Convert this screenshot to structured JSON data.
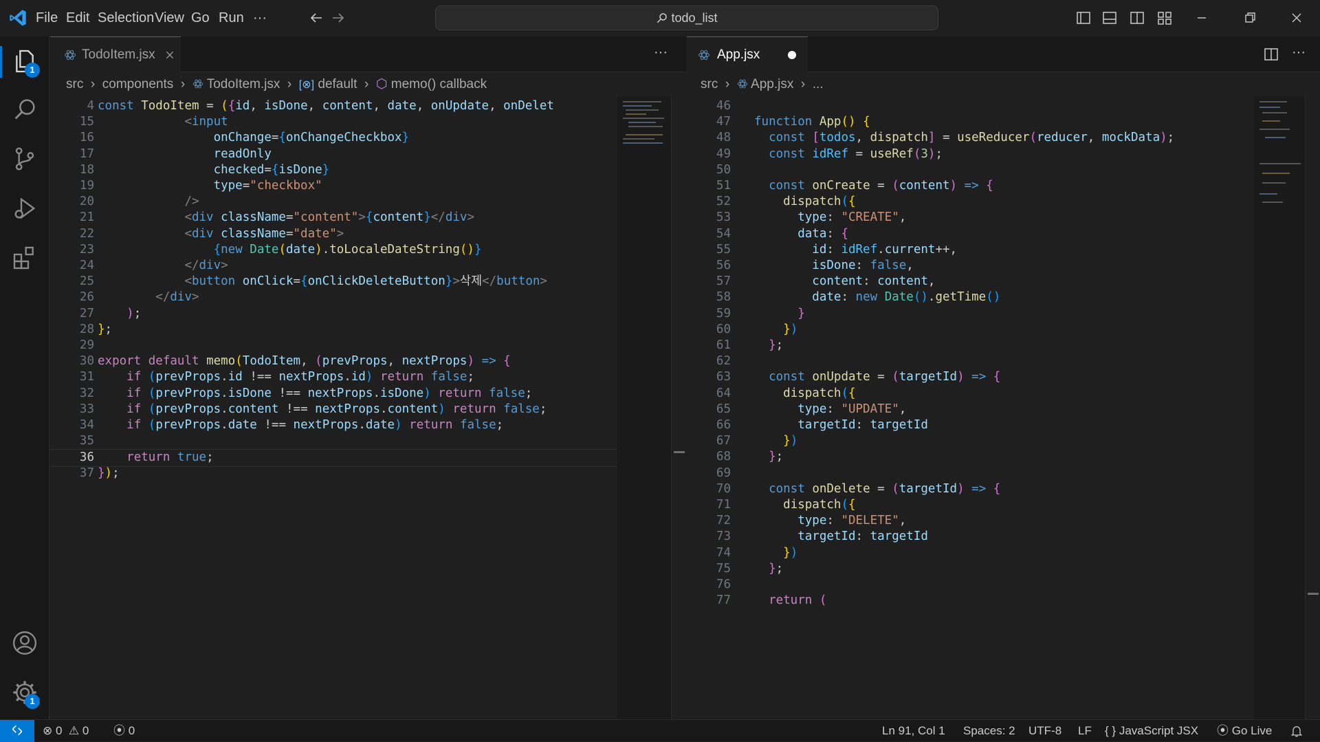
{
  "titlebar": {
    "menu": [
      "File",
      "Edit",
      "Selection",
      "View",
      "Go",
      "Run",
      "···"
    ],
    "search_text": "todo_list"
  },
  "activitybar": {
    "explorer_badge": "1",
    "settings_badge": "1"
  },
  "left_editor": {
    "tab": {
      "label": "TodoItem.jsx"
    },
    "more_label": "···",
    "breadcrumb": [
      "src",
      "components",
      "TodoItem.jsx",
      "default",
      "memo() callback"
    ],
    "lines": [
      {
        "n": "4",
        "html": "<span class=\"kw\">const</span> <span class=\"fn\">TodoItem</span> = <span class=\"br1\">(</span><span class=\"br2\">{</span><span class=\"vr\">id</span>, <span class=\"vr\">isDone</span>, <span class=\"vr\">content</span>, <span class=\"vr\">date</span>, <span class=\"vr\">onUpdate</span>, <span class=\"vr\">onDelet</span>"
      },
      {
        "n": "15",
        "html": "            <span class=\"ang\">&lt;</span><span class=\"tag\">input</span>"
      },
      {
        "n": "16",
        "html": "                <span class=\"vr\">onChange</span>=<span class=\"br3\">{</span><span class=\"vr\">onChangeCheckbox</span><span class=\"br3\">}</span>"
      },
      {
        "n": "17",
        "html": "                <span class=\"vr\">readOnly</span>"
      },
      {
        "n": "18",
        "html": "                <span class=\"vr\">checked</span>=<span class=\"br3\">{</span><span class=\"vr\">isDone</span><span class=\"br3\">}</span>"
      },
      {
        "n": "19",
        "html": "                <span class=\"vr\">type</span>=<span class=\"str\">\"checkbox\"</span>"
      },
      {
        "n": "20",
        "html": "            <span class=\"ang\">/&gt;</span>"
      },
      {
        "n": "21",
        "html": "            <span class=\"ang\">&lt;</span><span class=\"tag\">div</span> <span class=\"vr\">className</span>=<span class=\"str\">\"content\"</span><span class=\"ang\">&gt;</span><span class=\"br3\">{</span><span class=\"vr\">content</span><span class=\"br3\">}</span><span class=\"ang\">&lt;/</span><span class=\"tag\">div</span><span class=\"ang\">&gt;</span>"
      },
      {
        "n": "22",
        "html": "            <span class=\"ang\">&lt;</span><span class=\"tag\">div</span> <span class=\"vr\">className</span>=<span class=\"str\">\"date\"</span><span class=\"ang\">&gt;</span>"
      },
      {
        "n": "23",
        "html": "                <span class=\"br3\">{</span><span class=\"kw\">new</span> <span class=\"tp\">Date</span><span class=\"br1\">(</span><span class=\"vr\">date</span><span class=\"br1\">)</span>.<span class=\"fn\">toLocaleDateString</span><span class=\"br1\">()</span><span class=\"br3\">}</span>"
      },
      {
        "n": "24",
        "html": "            <span class=\"ang\">&lt;/</span><span class=\"tag\">div</span><span class=\"ang\">&gt;</span>"
      },
      {
        "n": "25",
        "html": "            <span class=\"ang\">&lt;</span><span class=\"tag\">button</span> <span class=\"vr\">onClick</span>=<span class=\"br3\">{</span><span class=\"vr\">onClickDeleteButton</span><span class=\"br3\">}</span><span class=\"ang\">&gt;</span>삭제<span class=\"ang\">&lt;/</span><span class=\"tag\">button</span><span class=\"ang\">&gt;</span>"
      },
      {
        "n": "26",
        "html": "        <span class=\"ang\">&lt;/</span><span class=\"tag\">div</span><span class=\"ang\">&gt;</span>"
      },
      {
        "n": "27",
        "html": "    <span class=\"br2\">)</span>;"
      },
      {
        "n": "28",
        "html": "<span class=\"br1\">}</span>;"
      },
      {
        "n": "29",
        "html": ""
      },
      {
        "n": "30",
        "html": "<span class=\"ctl\">export</span> <span class=\"ctl\">default</span> <span class=\"fn\">memo</span><span class=\"br1\">(</span><span class=\"vr\">TodoItem</span>, <span class=\"br2\">(</span><span class=\"vr\">prevProps</span>, <span class=\"vr\">nextProps</span><span class=\"br2\">)</span> <span class=\"kw\">=&gt;</span> <span class=\"br2\">{</span>"
      },
      {
        "n": "31",
        "html": "    <span class=\"ctl\">if</span> <span class=\"br3\">(</span><span class=\"vr\">prevProps</span>.<span class=\"vr\">id</span> !== <span class=\"vr\">nextProps</span>.<span class=\"vr\">id</span><span class=\"br3\">)</span> <span class=\"ctl\">return</span> <span class=\"kw\">false</span>;"
      },
      {
        "n": "32",
        "html": "    <span class=\"ctl\">if</span> <span class=\"br3\">(</span><span class=\"vr\">prevProps</span>.<span class=\"vr\">isDone</span> !== <span class=\"vr\">nextProps</span>.<span class=\"vr\">isDone</span><span class=\"br3\">)</span> <span class=\"ctl\">return</span> <span class=\"kw\">false</span>;"
      },
      {
        "n": "33",
        "html": "    <span class=\"ctl\">if</span> <span class=\"br3\">(</span><span class=\"vr\">prevProps</span>.<span class=\"vr\">content</span> !== <span class=\"vr\">nextProps</span>.<span class=\"vr\">content</span><span class=\"br3\">)</span> <span class=\"ctl\">return</span> <span class=\"kw\">false</span>;"
      },
      {
        "n": "34",
        "html": "    <span class=\"ctl\">if</span> <span class=\"br3\">(</span><span class=\"vr\">prevProps</span>.<span class=\"vr\">date</span> !== <span class=\"vr\">nextProps</span>.<span class=\"vr\">date</span><span class=\"br3\">)</span> <span class=\"ctl\">return</span> <span class=\"kw\">false</span>;"
      },
      {
        "n": "35",
        "html": ""
      },
      {
        "n": "36",
        "html": "    <span class=\"ctl\">return</span> <span class=\"kw\">true</span>;",
        "current": true
      },
      {
        "n": "37",
        "html": "<span class=\"br2\">}</span><span class=\"br1\">)</span>;"
      }
    ]
  },
  "right_editor": {
    "tab": {
      "label": "App.jsx"
    },
    "more_label": "···",
    "breadcrumb": [
      "src",
      "App.jsx",
      "..."
    ],
    "lines": [
      {
        "n": "46",
        "html": ""
      },
      {
        "n": "47",
        "html": "<span class=\"kw\">function</span> <span class=\"fn\">App</span><span class=\"br1\">()</span> <span class=\"br1\">{</span>"
      },
      {
        "n": "48",
        "html": "  <span class=\"kw\">const</span> <span class=\"br2\">[</span><span class=\"cn\">todos</span>, <span class=\"fn\">dispatch</span><span class=\"br2\">]</span> = <span class=\"fn\">useReducer</span><span class=\"br2\">(</span><span class=\"vr\">reducer</span>, <span class=\"vr\">mockData</span><span class=\"br2\">)</span>;"
      },
      {
        "n": "49",
        "html": "  <span class=\"kw\">const</span> <span class=\"cn\">idRef</span> = <span class=\"fn\">useRef</span><span class=\"br2\">(</span><span class=\"num\">3</span><span class=\"br2\">)</span>;"
      },
      {
        "n": "50",
        "html": ""
      },
      {
        "n": "51",
        "html": "  <span class=\"kw\">const</span> <span class=\"fn\">onCreate</span> = <span class=\"br2\">(</span><span class=\"vr\">content</span><span class=\"br2\">)</span> <span class=\"kw\">=&gt;</span> <span class=\"br2\">{</span>"
      },
      {
        "n": "52",
        "html": "    <span class=\"fn\">dispatch</span><span class=\"br3\">(</span><span class=\"br1\">{</span>"
      },
      {
        "n": "53",
        "html": "      <span class=\"vr\">type</span>: <span class=\"str\">\"CREATE\"</span>,"
      },
      {
        "n": "54",
        "html": "      <span class=\"vr\">data</span>: <span class=\"br2\">{</span>"
      },
      {
        "n": "55",
        "html": "        <span class=\"vr\">id</span>: <span class=\"cn\">idRef</span>.<span class=\"vr\">current</span>++,"
      },
      {
        "n": "56",
        "html": "        <span class=\"vr\">isDone</span>: <span class=\"kw\">false</span>,"
      },
      {
        "n": "57",
        "html": "        <span class=\"vr\">content</span>: <span class=\"vr\">content</span>,"
      },
      {
        "n": "58",
        "html": "        <span class=\"vr\">date</span>: <span class=\"kw\">new</span> <span class=\"tp\">Date</span><span class=\"br3\">()</span>.<span class=\"fn\">getTime</span><span class=\"br3\">()</span>"
      },
      {
        "n": "59",
        "html": "      <span class=\"br2\">}</span>"
      },
      {
        "n": "60",
        "html": "    <span class=\"br1\">}</span><span class=\"br3\">)</span>"
      },
      {
        "n": "61",
        "html": "  <span class=\"br2\">}</span>;"
      },
      {
        "n": "62",
        "html": ""
      },
      {
        "n": "63",
        "html": "  <span class=\"kw\">const</span> <span class=\"fn\">onUpdate</span> = <span class=\"br2\">(</span><span class=\"vr\">targetId</span><span class=\"br2\">)</span> <span class=\"kw\">=&gt;</span> <span class=\"br2\">{</span>"
      },
      {
        "n": "64",
        "html": "    <span class=\"fn\">dispatch</span><span class=\"br3\">(</span><span class=\"br1\">{</span>"
      },
      {
        "n": "65",
        "html": "      <span class=\"vr\">type</span>: <span class=\"str\">\"UPDATE\"</span>,"
      },
      {
        "n": "66",
        "html": "      <span class=\"vr\">targetId</span>: <span class=\"vr\">targetId</span>"
      },
      {
        "n": "67",
        "html": "    <span class=\"br1\">}</span><span class=\"br3\">)</span>"
      },
      {
        "n": "68",
        "html": "  <span class=\"br2\">}</span>;"
      },
      {
        "n": "69",
        "html": ""
      },
      {
        "n": "70",
        "html": "  <span class=\"kw\">const</span> <span class=\"fn\">onDelete</span> = <span class=\"br2\">(</span><span class=\"vr\">targetId</span><span class=\"br2\">)</span> <span class=\"kw\">=&gt;</span> <span class=\"br2\">{</span>"
      },
      {
        "n": "71",
        "html": "    <span class=\"fn\">dispatch</span><span class=\"br3\">(</span><span class=\"br1\">{</span>"
      },
      {
        "n": "72",
        "html": "      <span class=\"vr\">type</span>: <span class=\"str\">\"DELETE\"</span>,"
      },
      {
        "n": "73",
        "html": "      <span class=\"vr\">targetId</span>: <span class=\"vr\">targetId</span>"
      },
      {
        "n": "74",
        "html": "    <span class=\"br1\">}</span><span class=\"br3\">)</span>"
      },
      {
        "n": "75",
        "html": "  <span class=\"br2\">}</span>;"
      },
      {
        "n": "76",
        "html": ""
      },
      {
        "n": "77",
        "html": "  <span class=\"ctl\">return</span> <span class=\"br2\">(</span>"
      }
    ]
  },
  "statusbar": {
    "errors": "0",
    "warnings": "0",
    "ports": "0",
    "position": "Ln 91, Col 1",
    "spaces": "Spaces: 2",
    "encoding": "UTF-8",
    "eol": "LF",
    "language_prefix": "{ }",
    "language": "JavaScript JSX",
    "golive": "Go Live"
  },
  "colors": {
    "accent": "#0078d4",
    "remote": "#0078d4",
    "background": "#1f1f1f"
  }
}
